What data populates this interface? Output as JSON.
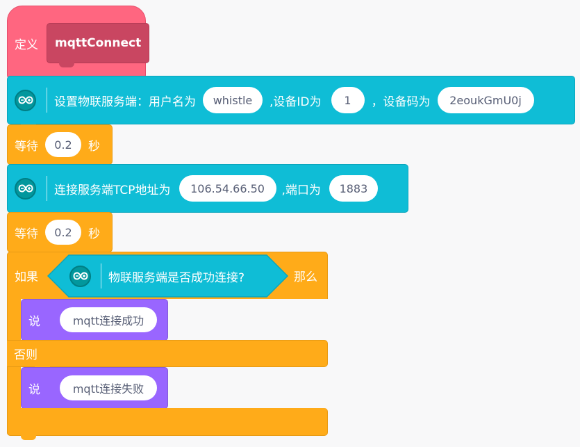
{
  "define_block": {
    "keyword": "定义",
    "name": "mqttConnect"
  },
  "iot_server_block": {
    "label": "设置物联服务端：用户名为",
    "username": "whistle",
    "device_id_label": ",设备ID为",
    "device_id": "1",
    "device_code_label": "，设备码为",
    "device_code": "2eoukGmU0j"
  },
  "wait_1": {
    "label": "等待",
    "value": "0.2",
    "unit": "秒"
  },
  "tcp_block": {
    "label": "连接服务端TCP地址为",
    "address": "106.54.66.50",
    "port_label": ",端口为",
    "port": "1883"
  },
  "wait_2": {
    "label": "等待",
    "value": "0.2",
    "unit": "秒"
  },
  "if_block": {
    "if_label": "如果",
    "condition": "物联服务端是否成功连接?",
    "then_label": "那么",
    "else_label": "否则"
  },
  "say_1": {
    "label": "说",
    "text": "mqtt连接成功"
  },
  "say_2": {
    "label": "说",
    "text": "mqtt连接失败"
  },
  "colors": {
    "define": "#ff6680",
    "define_inner": "#c94661",
    "arduino": "#0fbdd6",
    "control": "#ffab19",
    "looks": "#9966ff",
    "canvas": "#f8f8f9"
  },
  "icons": {
    "arduino": "infinity-icon"
  }
}
